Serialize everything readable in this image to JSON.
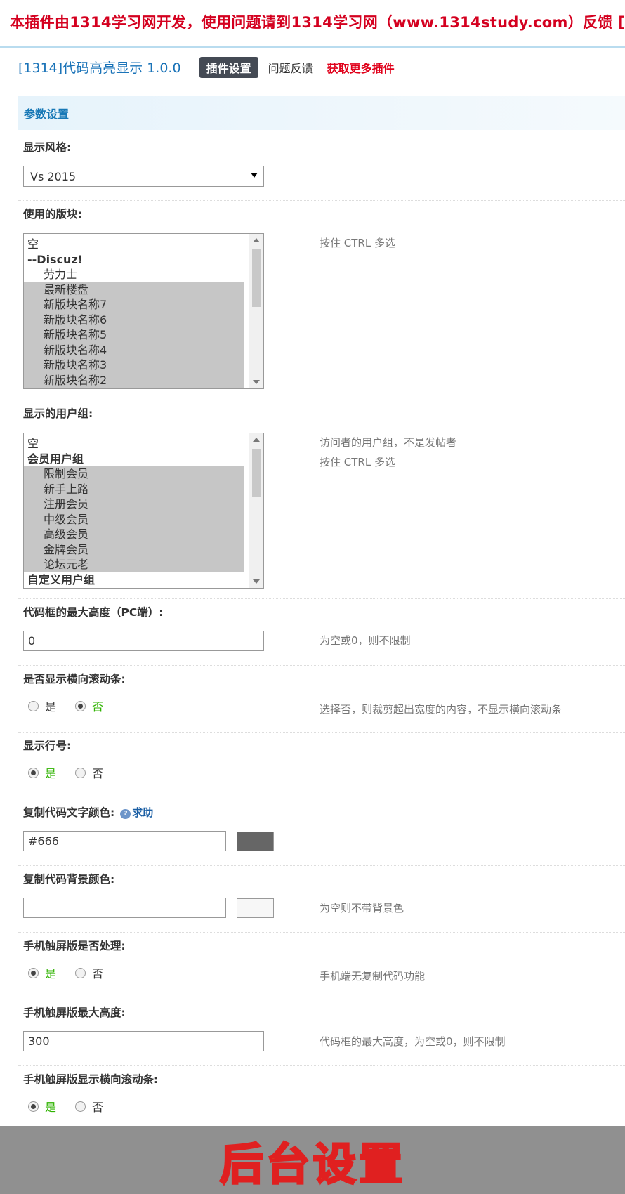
{
  "banner": {
    "text": "本插件由1314学习网开发，使用问题请到1314学习网（www.1314study.com）反馈 ["
  },
  "nav": {
    "title": "[1314]代码高亮显示 1.0.0",
    "tabs": [
      "插件设置",
      "问题反馈",
      "获取更多插件"
    ]
  },
  "section": {
    "title": "参数设置"
  },
  "fields": {
    "style": {
      "label": "显示风格:",
      "value": "Vs 2015"
    },
    "forums": {
      "label": "使用的版块:",
      "desc": "按住 CTRL 多选",
      "options": [
        "空",
        "--Discuz!",
        "劳力士",
        "最新楼盘",
        "新版块名称7",
        "新版块名称6",
        "新版块名称5",
        "新版块名称4",
        "新版块名称3",
        "新版块名称2"
      ]
    },
    "groups": {
      "label": "显示的用户组:",
      "desc1": "访问者的用户组，不是发帖者",
      "desc2": "按住 CTRL 多选",
      "options": [
        "空",
        "会员用户组",
        "限制会员",
        "新手上路",
        "注册会员",
        "中级会员",
        "高级会员",
        "金牌会员",
        "论坛元老",
        "自定义用户组"
      ]
    },
    "max_height_pc": {
      "label": "代码框的最大高度（PC端）:",
      "value": "0",
      "desc": "为空或0，则不限制"
    },
    "hscroll": {
      "label": "是否显示横向滚动条:",
      "yes": "是",
      "no": "否",
      "desc": "选择否，则裁剪超出宽度的内容，不显示横向滚动条"
    },
    "line_numbers": {
      "label": "显示行号:",
      "yes": "是",
      "no": "否"
    },
    "copy_text_color": {
      "label": "复制代码文字颜色:",
      "help": "求助",
      "value": "#666",
      "swatch": "#666666"
    },
    "copy_bg_color": {
      "label": "复制代码背景颜色:",
      "value": "",
      "desc": "为空则不带背景色",
      "swatch": "#f7f7f7"
    },
    "mobile_enable": {
      "label": "手机触屏版是否处理:",
      "yes": "是",
      "no": "否",
      "desc": "手机端无复制代码功能"
    },
    "mobile_max_height": {
      "label": "手机触屏版最大高度:",
      "value": "300",
      "desc": "代码框的最大高度，为空或0，则不限制"
    },
    "mobile_hscroll": {
      "label": "手机触屏版显示横向滚动条:",
      "yes": "是",
      "no": "否"
    }
  },
  "footer": {
    "text": "后台设置"
  }
}
